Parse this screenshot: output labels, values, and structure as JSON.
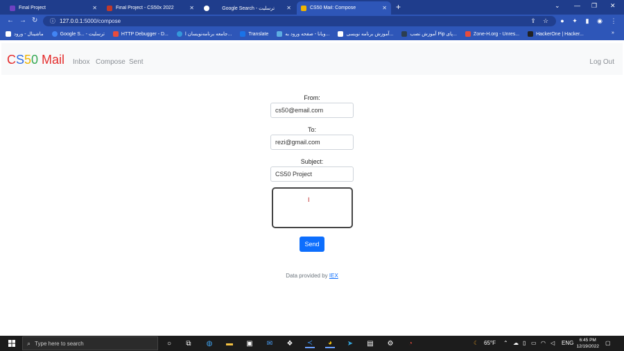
{
  "browser": {
    "tabs": [
      {
        "title": "Final Project",
        "color": "#6f42c1"
      },
      {
        "title": "Final Project - CS50x 2022",
        "color": "#c0392b"
      },
      {
        "title": "Google Search - ترسلیت",
        "color": "#4285f4"
      },
      {
        "title": "CS50 Mail: Compose",
        "color": "#f0b400"
      }
    ],
    "new_tab": "+",
    "url_host": "127.0.0.1",
    "url_rest": ":5000/compose",
    "bookmarks": [
      {
        "label": "ماشینال - ورود",
        "color": "#ffffff"
      },
      {
        "label": "Google S... - ترسلیت",
        "color": "#4285f4"
      },
      {
        "label": "HTTP Debugger - D...",
        "color": "#e74c3c"
      },
      {
        "label": "جامعه برنامه‌نویسان ا...",
        "color": "#3498db"
      },
      {
        "label": "Translate",
        "color": "#1a73e8"
      },
      {
        "label": "ویانا - صفحه ورود به...",
        "color": "#5dade2"
      },
      {
        "label": "آموزش برنامه نویسی...",
        "color": "#ffffff"
      },
      {
        "label": "آموزش نصب Pip پای...",
        "color": "#2c3e50"
      },
      {
        "label": "Zone-H.org - Unres...",
        "color": "#e74c3c"
      },
      {
        "label": "HackerOne | Hacker...",
        "color": "#222222"
      }
    ]
  },
  "app": {
    "brand": {
      "c": "C",
      "s": "S",
      "five": "5",
      "zero": "0",
      "mail": " Mail"
    },
    "nav": {
      "inbox": "Inbox",
      "compose": "Compose",
      "sent": "Sent",
      "logout": "Log Out"
    },
    "form": {
      "from_label": "From:",
      "from_value": "cs50@email.com",
      "to_label": "To:",
      "to_value": "rezi@gmail.com",
      "subject_label": "Subject:",
      "subject_value": "CS50 Project",
      "body_value": "",
      "send_label": "Send"
    },
    "footer": {
      "text": "Data provided by ",
      "link": "IEX"
    }
  },
  "taskbar": {
    "search_placeholder": "Type here to search",
    "weather": "65°F",
    "lang": "ENG",
    "time": "6:45 PM",
    "date": "12/19/2022"
  }
}
